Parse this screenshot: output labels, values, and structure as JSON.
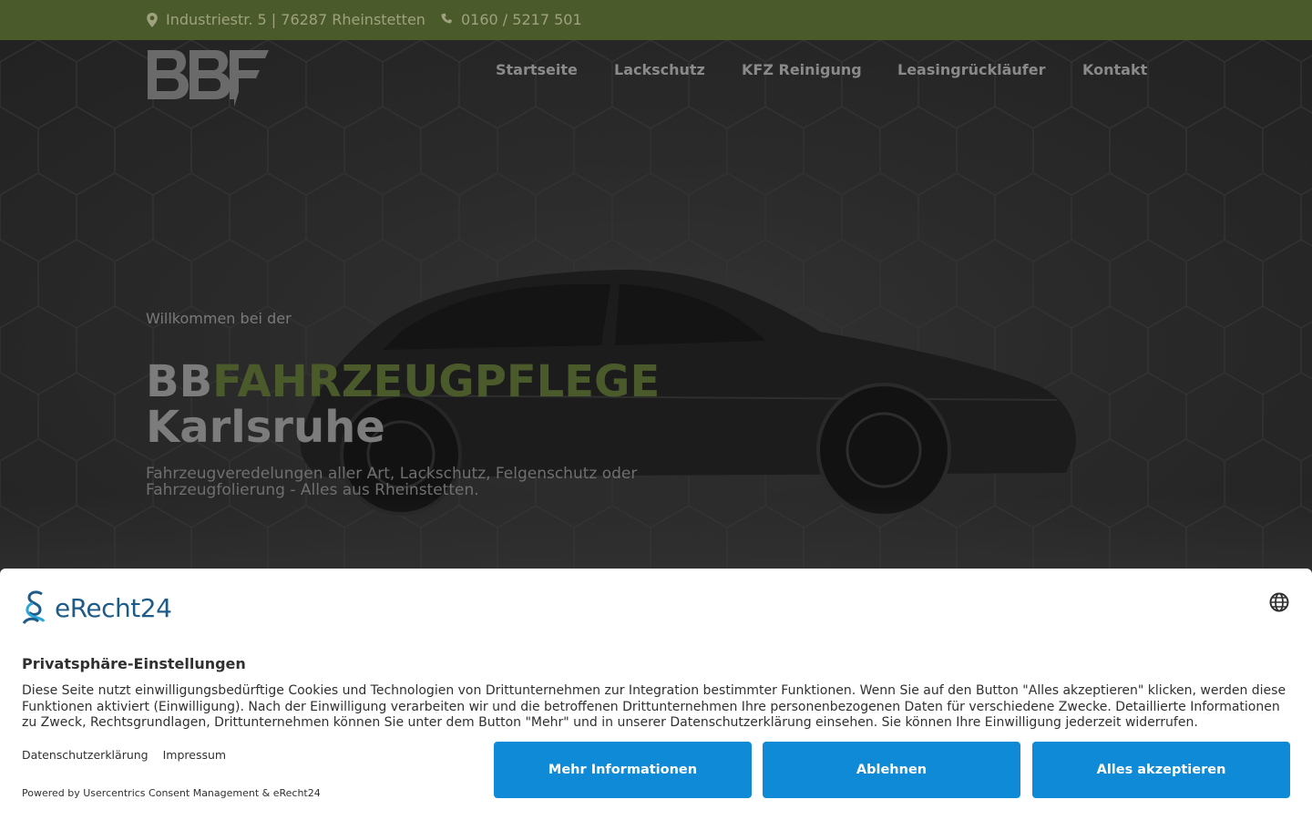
{
  "topbar": {
    "address": "Industriestr. 5 | 76287 Rheinstetten",
    "phone": "0160 / 5217 501",
    "address_icon": "map-marker-icon",
    "phone_icon": "phone-icon",
    "background": "#4b5a2a"
  },
  "nav": {
    "items": [
      "Startseite",
      "Lackschutz",
      "KFZ Reinigung",
      "Leasingrückläufer",
      "Kontakt"
    ]
  },
  "hero": {
    "welcome": "Willkommen bei der",
    "headline_part1": "BB",
    "headline_part2": "FAHRZEUGPFLEGE",
    "headline_line2": "Karlsruhe",
    "subline": "Fahrzeugveredelungen aller Art, Lackschutz, Felgenschutz oder Fahrzeugfolierung - Alles aus Rheinstetten."
  },
  "consent": {
    "brand": "eRecht24",
    "title": "Privatsphäre-Einstellungen",
    "text": "Diese Seite nutzt einwilligungsbedürftige Cookies und Technologien von Drittunternehmen zur Integration bestimmter Funktionen. Wenn Sie auf den Button \"Alles akzeptieren\" klicken, werden diese Funktionen aktiviert (Einwilligung). Nach der Einwilligung verarbeiten wir und die betroffenen Drittunternehmen Ihre personenbezogenen Daten für verschiedene Zwecke. Detaillierte Informationen zu Zweck, Rechtsgrundlagen, Drittunternehmen können Sie unter dem Button \"Mehr\" und in unserer Datenschutzerklärung einsehen. Sie können Ihre Einwilligung jederzeit widerrufen.",
    "link_privacy": "Datenschutzerklärung",
    "link_imprint": "Impressum",
    "powered": "Powered by Usercentrics Consent Management & eRecht24",
    "btn_more": "Mehr Informationen",
    "btn_decline": "Ablehnen",
    "btn_accept": "Alles akzeptieren",
    "button_color": "#0f8ad6"
  }
}
